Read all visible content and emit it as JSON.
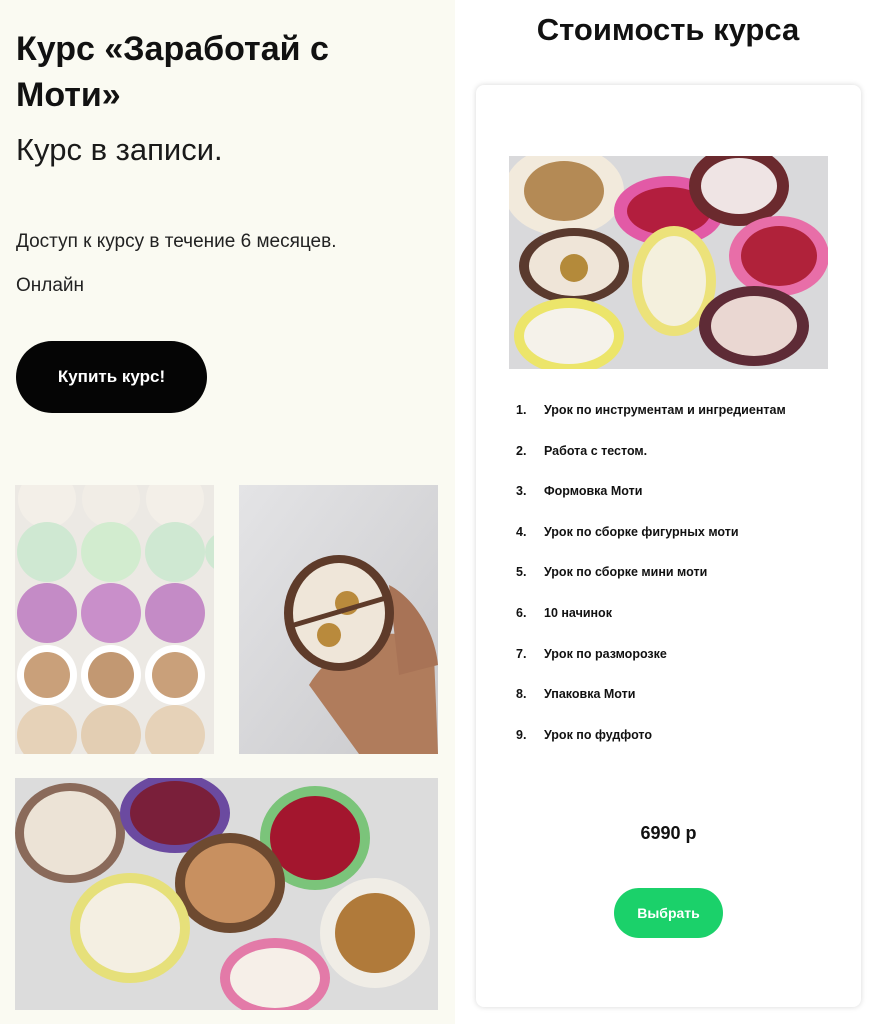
{
  "course": {
    "title": "Курс «Заработай с Моти»",
    "subtitle": "Курс в записи.",
    "access": "Доступ к курсу в течение 6 месяцев.",
    "format": "Онлайн",
    "buy_label": "Купить курс!"
  },
  "pricing": {
    "heading": "Стоимость курса",
    "lessons": [
      {
        "num": "1.",
        "label": "Урок по инструментам и ингредиентам"
      },
      {
        "num": "2.",
        "label": "Работа с тестом."
      },
      {
        "num": "3.",
        "label": "Формовка Моти"
      },
      {
        "num": "4.",
        "label": "Урок по сборке фигурных моти"
      },
      {
        "num": "5.",
        "label": "Урок по сборке мини моти"
      },
      {
        "num": "6.",
        "label": "10 начинок"
      },
      {
        "num": "7.",
        "label": "Урок по разморозке"
      },
      {
        "num": "8.",
        "label": "Упаковка Моти"
      },
      {
        "num": "9.",
        "label": "Урок по фудфото"
      }
    ],
    "price": "6990 р",
    "select_label": "Выбрать"
  },
  "colors": {
    "left_background": "#fafaf2",
    "buy_button": "#050505",
    "select_button": "#1bd16a"
  }
}
